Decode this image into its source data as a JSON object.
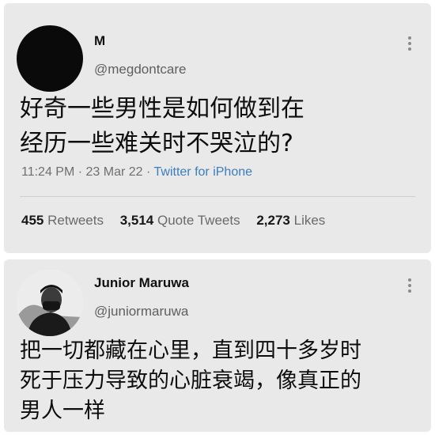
{
  "tweets": [
    {
      "display_name": "M",
      "handle": "@megdontcare",
      "text_lines": [
        "好奇一些男性是如何做到在",
        "经历一些难关时不哭泣的?"
      ],
      "time": "11:24 PM",
      "date": "23 Mar 22",
      "source": "Twitter for iPhone",
      "stats": {
        "retweets_count": "455",
        "retweets_label": "Retweets",
        "quotes_count": "3,514",
        "quotes_label": "Quote Tweets",
        "likes_count": "2,273",
        "likes_label": "Likes"
      }
    },
    {
      "display_name": "Junior Maruwa",
      "handle": "@juniormaruwa",
      "text_lines": [
        "把一切都藏在心里，直到四十多岁时",
        "死于压力导致的心脏衰竭，像真正的",
        "男人一样"
      ]
    }
  ],
  "icons": {
    "more": "more-vertical-icon"
  },
  "colors": {
    "card_background": "#e9e9e9",
    "link_blue": "#3a7ebd",
    "avatar1": "#0a0a0a"
  }
}
